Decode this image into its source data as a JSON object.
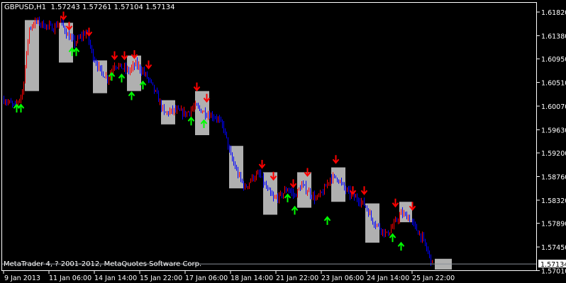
{
  "header": {
    "symbol": "GBPUSD,H1",
    "open": "1.57243",
    "high": "1.57261",
    "low": "1.57104",
    "close": "1.57134"
  },
  "copyright": "MetaTrader 4, ? 2001-2012, MetaQuotes Software Corp.",
  "colors": {
    "background": "#000000",
    "bull_bar": "#ff0000",
    "bear_bar": "#0000ff",
    "box": "#b0b0b0",
    "sell_arrow": "#ff0000",
    "buy_arrow": "#00ff00",
    "frame": "#ffffff",
    "price_line": "#8a8f99"
  },
  "chart_data": {
    "type": "bar",
    "ylim": [
      1.5701,
      1.6199
    ],
    "y_ticks": [
      "1.61820",
      "1.61380",
      "1.60950",
      "1.60510",
      "1.60070",
      "1.59630",
      "1.59200",
      "1.58760",
      "1.58320",
      "1.57890",
      "1.57450",
      "1.57010"
    ],
    "x_ticks": [
      {
        "bar": 1,
        "label": "9 Jan 2013"
      },
      {
        "bar": 33,
        "label": "11 Jan 06:00"
      },
      {
        "bar": 65,
        "label": "14 Jan 14:00"
      },
      {
        "bar": 97,
        "label": "15 Jan 22:00"
      },
      {
        "bar": 129,
        "label": "17 Jan 06:00"
      },
      {
        "bar": 161,
        "label": "18 Jan 14:00"
      },
      {
        "bar": 193,
        "label": "21 Jan 22:00"
      },
      {
        "bar": 225,
        "label": "23 Jan 06:00"
      },
      {
        "bar": 257,
        "label": "24 Jan 14:00"
      },
      {
        "bar": 289,
        "label": "25 Jan 22:00"
      }
    ],
    "last_price": "1.57134",
    "price_path": [
      [
        2,
        1.6019
      ],
      [
        10,
        1.6006
      ],
      [
        15,
        1.6032
      ],
      [
        20,
        1.6152
      ],
      [
        25,
        1.6165
      ],
      [
        30,
        1.6158
      ],
      [
        37,
        1.6152
      ],
      [
        42,
        1.6165
      ],
      [
        47,
        1.6138
      ],
      [
        52,
        1.6125
      ],
      [
        60,
        1.6145
      ],
      [
        65,
        1.6099
      ],
      [
        70,
        1.6072
      ],
      [
        75,
        1.6059
      ],
      [
        80,
        1.6085
      ],
      [
        85,
        1.6079
      ],
      [
        90,
        1.6072
      ],
      [
        95,
        1.6085
      ],
      [
        100,
        1.6072
      ],
      [
        105,
        1.6052
      ],
      [
        110,
        1.6026
      ],
      [
        115,
        1.5993
      ],
      [
        122,
        1.5999
      ],
      [
        130,
        1.5993
      ],
      [
        137,
        1.6006
      ],
      [
        145,
        1.5993
      ],
      [
        152,
        1.5986
      ],
      [
        157,
        1.5966
      ],
      [
        162,
        1.5913
      ],
      [
        167,
        1.588
      ],
      [
        172,
        1.5854
      ],
      [
        177,
        1.5874
      ],
      [
        182,
        1.588
      ],
      [
        187,
        1.5854
      ],
      [
        192,
        1.5834
      ],
      [
        197,
        1.584
      ],
      [
        202,
        1.5854
      ],
      [
        207,
        1.584
      ],
      [
        212,
        1.586
      ],
      [
        217,
        1.5847
      ],
      [
        222,
        1.5834
      ],
      [
        227,
        1.5847
      ],
      [
        232,
        1.5874
      ],
      [
        237,
        1.5874
      ],
      [
        242,
        1.5854
      ],
      [
        247,
        1.584
      ],
      [
        252,
        1.5834
      ],
      [
        257,
        1.5821
      ],
      [
        262,
        1.5794
      ],
      [
        267,
        1.5781
      ],
      [
        272,
        1.5768
      ],
      [
        277,
        1.5787
      ],
      [
        282,
        1.5807
      ],
      [
        287,
        1.5801
      ],
      [
        292,
        1.5781
      ],
      [
        297,
        1.5761
      ],
      [
        302,
        1.5728
      ],
      [
        304,
        1.57134
      ]
    ],
    "boxes": [
      {
        "from": 17,
        "to": 27,
        "high": 1.6167,
        "low": 1.6035
      },
      {
        "from": 41,
        "to": 51,
        "high": 1.6162,
        "low": 1.6088
      },
      {
        "from": 65,
        "to": 75,
        "high": 1.6092,
        "low": 1.6031
      },
      {
        "from": 89,
        "to": 99,
        "high": 1.6101,
        "low": 1.6035
      },
      {
        "from": 113,
        "to": 123,
        "high": 1.6018,
        "low": 1.5973
      },
      {
        "from": 137,
        "to": 147,
        "high": 1.6035,
        "low": 1.5953
      },
      {
        "from": 161,
        "to": 171,
        "high": 1.5933,
        "low": 1.5854
      },
      {
        "from": 185,
        "to": 195,
        "high": 1.5884,
        "low": 1.5805
      },
      {
        "from": 209,
        "to": 219,
        "high": 1.5884,
        "low": 1.5818
      },
      {
        "from": 233,
        "to": 243,
        "high": 1.5893,
        "low": 1.5829
      },
      {
        "from": 257,
        "to": 267,
        "high": 1.5826,
        "low": 1.5753
      },
      {
        "from": 281,
        "to": 290,
        "high": 1.5829,
        "low": 1.5791
      },
      {
        "from": 306,
        "to": 318,
        "high": 1.5723,
        "low": 1.5703
      }
    ],
    "sell_arrows": [
      [
        44,
        1.6175
      ],
      [
        48,
        1.6156
      ],
      [
        62,
        1.6145
      ],
      [
        80,
        1.6101
      ],
      [
        87,
        1.6101
      ],
      [
        94,
        1.6103
      ],
      [
        104,
        1.6084
      ],
      [
        138,
        1.6043
      ],
      [
        145,
        1.6022
      ],
      [
        184,
        1.5899
      ],
      [
        192,
        1.5877
      ],
      [
        206,
        1.5863
      ],
      [
        216,
        1.5884
      ],
      [
        236,
        1.5908
      ],
      [
        248,
        1.585
      ],
      [
        256,
        1.585
      ],
      [
        278,
        1.5827
      ],
      [
        290,
        1.5821
      ]
    ],
    "buy_arrows": [
      [
        11,
        1.6003
      ],
      [
        14,
        1.6003
      ],
      [
        50,
        1.6108
      ],
      [
        53,
        1.6108
      ],
      [
        78,
        1.6062
      ],
      [
        85,
        1.6059
      ],
      [
        92,
        1.6026
      ],
      [
        100,
        1.6046
      ],
      [
        134,
        1.5979
      ],
      [
        143,
        1.5974
      ],
      [
        202,
        1.5836
      ],
      [
        207,
        1.5813
      ],
      [
        230,
        1.5794
      ],
      [
        276,
        1.5762
      ],
      [
        282,
        1.5746
      ]
    ]
  }
}
